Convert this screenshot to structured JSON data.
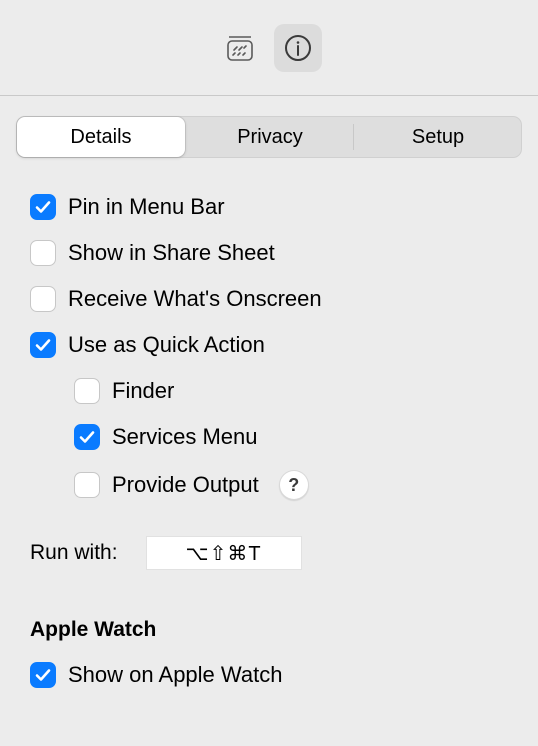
{
  "toolbar": {
    "buttons": [
      {
        "name": "toolbar-media-icon"
      },
      {
        "name": "info-icon"
      }
    ],
    "active_index": 1
  },
  "tabs": {
    "items": [
      "Details",
      "Privacy",
      "Setup"
    ],
    "selected_index": 0
  },
  "options": {
    "pin_menu_bar": {
      "label": "Pin in Menu Bar",
      "checked": true
    },
    "share_sheet": {
      "label": "Show in Share Sheet",
      "checked": false
    },
    "receive_onscreen": {
      "label": "Receive What's Onscreen",
      "checked": false
    },
    "quick_action": {
      "label": "Use as Quick Action",
      "checked": true
    },
    "finder": {
      "label": "Finder",
      "checked": false
    },
    "services_menu": {
      "label": "Services Menu",
      "checked": true
    },
    "provide_output": {
      "label": "Provide Output",
      "checked": false
    }
  },
  "help_glyph": "?",
  "run_with": {
    "label": "Run with:",
    "value": "⌥⇧⌘T"
  },
  "apple_watch_section": {
    "title": "Apple Watch",
    "show_on_watch": {
      "label": "Show on Apple Watch",
      "checked": true
    }
  }
}
